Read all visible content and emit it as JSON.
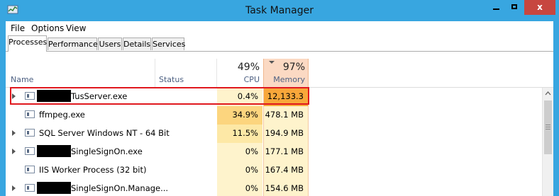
{
  "window": {
    "title": "Task Manager",
    "close_glyph": "x",
    "icons": {
      "app": "task-manager-icon",
      "min": "minimize-icon",
      "max": "maximize-icon",
      "close": "close-icon"
    }
  },
  "menu": [
    "File",
    "Options",
    "View"
  ],
  "tabs": [
    "Processes",
    "Performance",
    "Users",
    "Details",
    "Services"
  ],
  "active_tab": "Processes",
  "columns": {
    "name": "Name",
    "status": "Status",
    "cpu_pct": "49%",
    "cpu_label": "CPU",
    "mem_pct": "97%",
    "mem_label": "Memory"
  },
  "rows": [
    {
      "name": "TusServer.exe",
      "expandable": true,
      "redacted_prefix": true,
      "cpu": "0.4%",
      "memory": "12,133.3 ...",
      "cpu_color": "#fef3cc",
      "mem_color": "#f8a73a",
      "highlighted": true
    },
    {
      "name": "ffmpeg.exe",
      "expandable": false,
      "redacted_prefix": false,
      "cpu": "34.9%",
      "memory": "478.1 MB",
      "cpu_color": "#fcd57e",
      "mem_color": "#fef3cc"
    },
    {
      "name": "SQL Server Windows NT - 64 Bit",
      "expandable": true,
      "redacted_prefix": false,
      "cpu": "11.5%",
      "memory": "194.9 MB",
      "cpu_color": "#fde8a6",
      "mem_color": "#fef3cc"
    },
    {
      "name": "SingleSignOn.exe",
      "expandable": true,
      "redacted_prefix": true,
      "cpu": "0%",
      "memory": "177.1 MB",
      "cpu_color": "#fef3cc",
      "mem_color": "#fef3cc"
    },
    {
      "name": "IIS Worker Process (32 bit)",
      "expandable": false,
      "redacted_prefix": false,
      "cpu": "0%",
      "memory": "167.4 MB",
      "cpu_color": "#fef3cc",
      "mem_color": "#fef3cc"
    },
    {
      "name": "SingleSignOn.Manage...",
      "expandable": true,
      "redacted_prefix": true,
      "cpu": "0%",
      "memory": "154.6 MB",
      "cpu_color": "#fef3cc",
      "mem_color": "#fef3cc"
    }
  ]
}
